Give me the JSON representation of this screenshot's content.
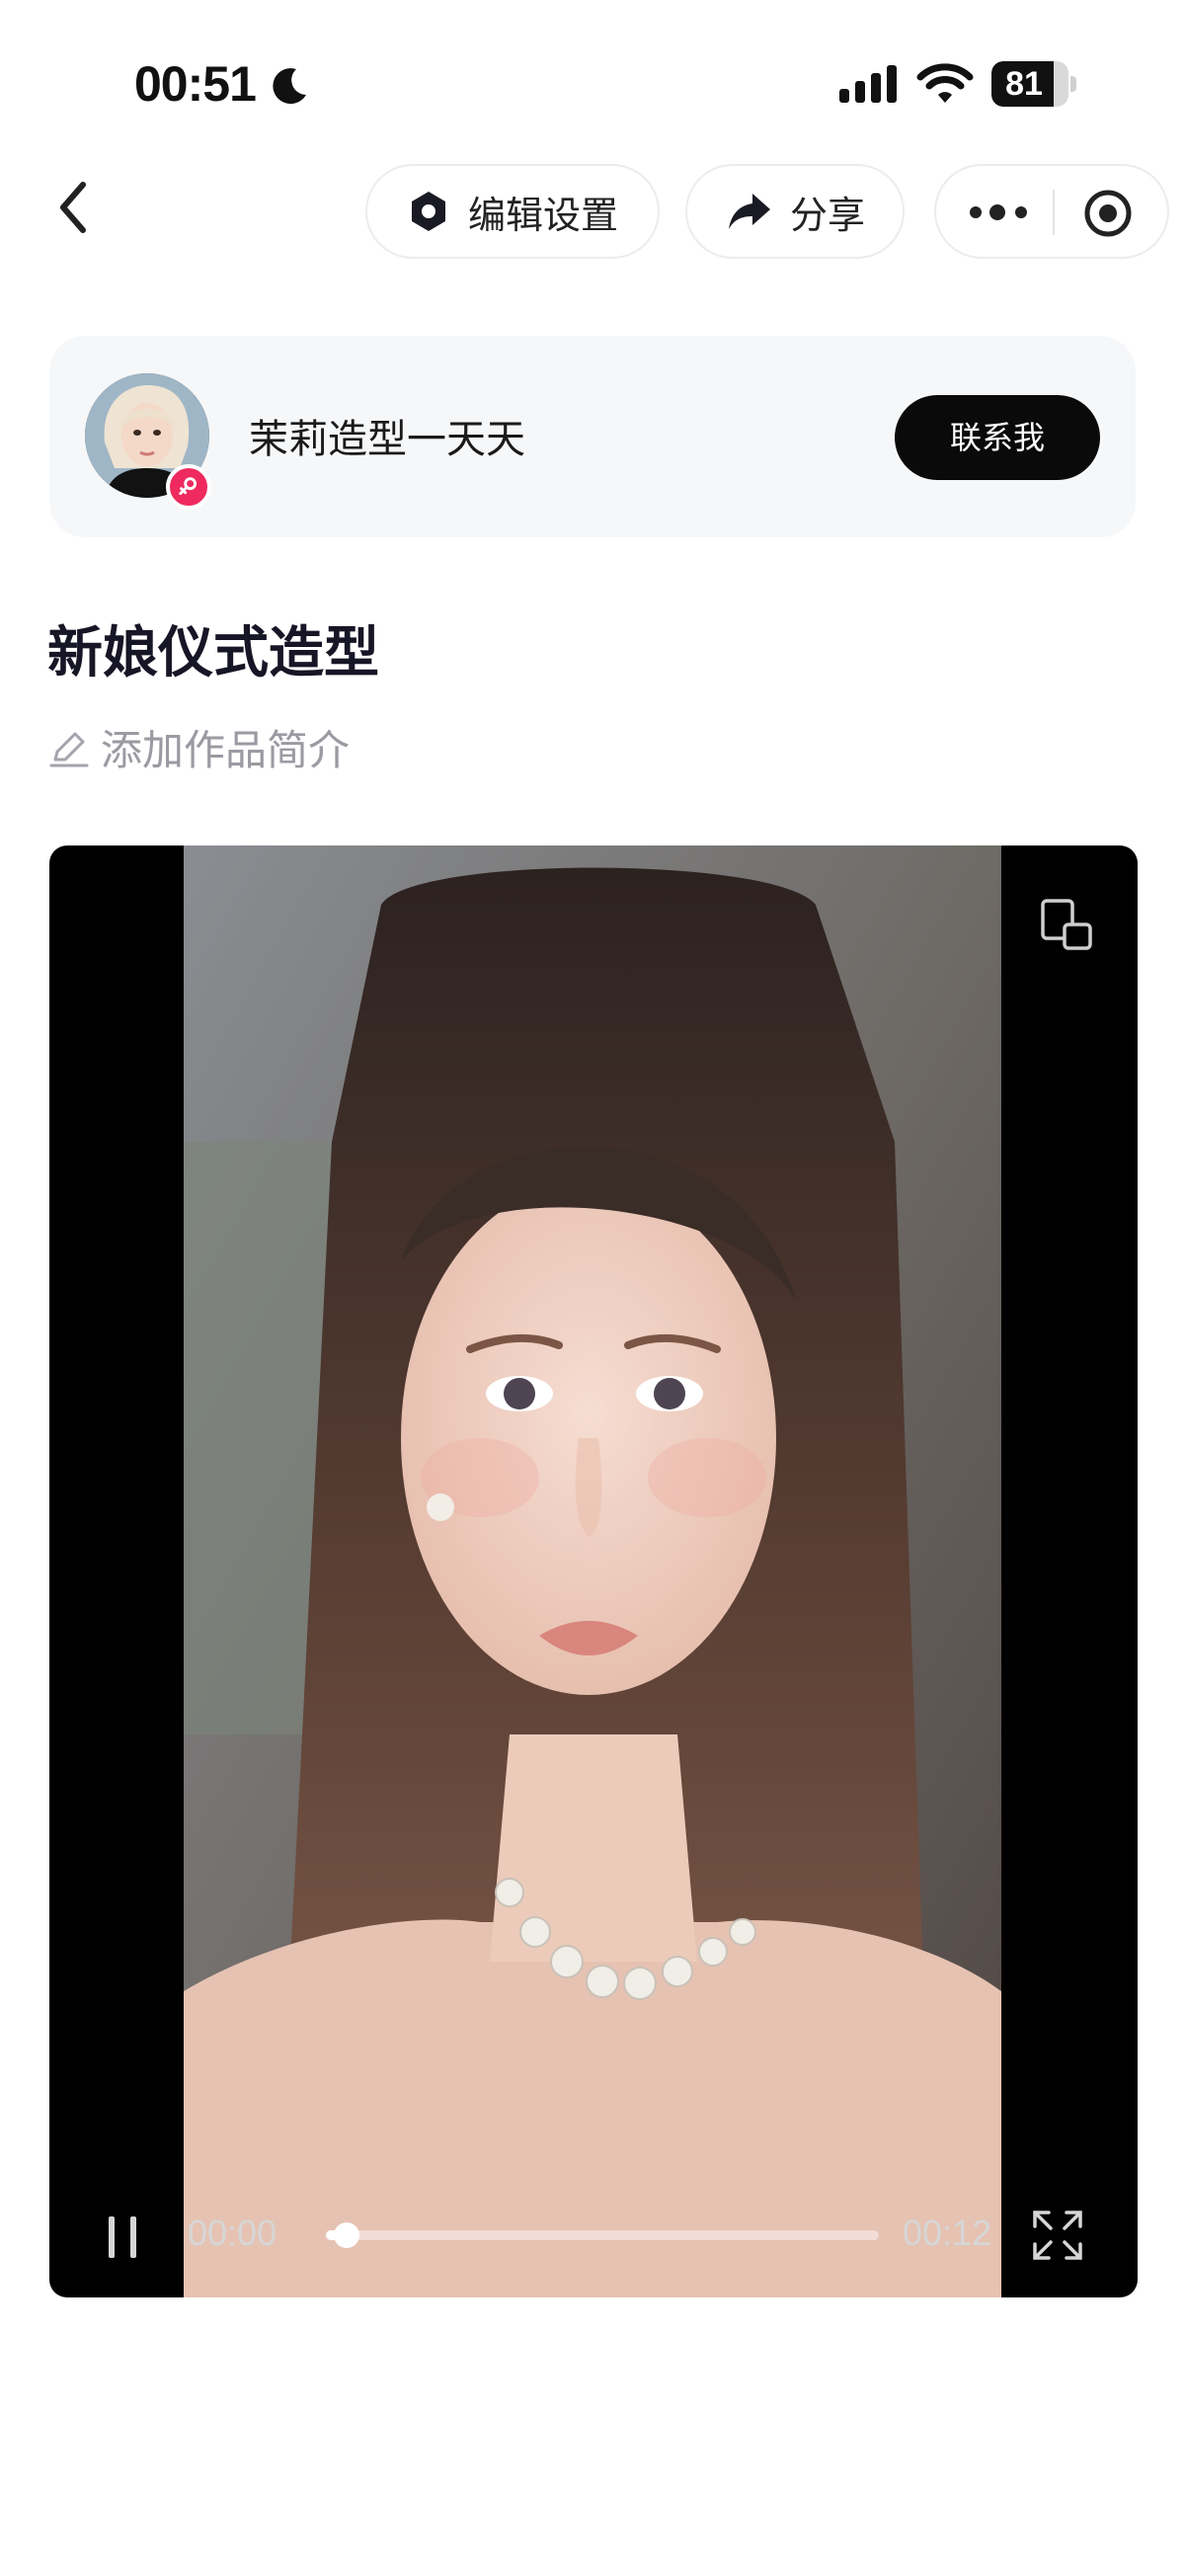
{
  "status_bar": {
    "time": "00:51",
    "battery_level": "81",
    "battery_fraction": 0.81
  },
  "nav": {
    "edit_settings_label": "编辑设置",
    "share_label": "分享"
  },
  "author": {
    "name": "茉莉造型一天天",
    "contact_label": "联系我",
    "badge_color": "#ee2a5e"
  },
  "work": {
    "title": "新娘仪式造型",
    "intro_placeholder": "添加作品简介"
  },
  "video": {
    "current_time": "00:00",
    "total_time": "00:12",
    "progress_fraction": 0.0
  },
  "icons": {
    "back": "chevron-left-icon",
    "settings": "hexagon-gear-icon",
    "share": "share-arrow-icon",
    "more": "more-dots-icon",
    "target": "record-target-icon",
    "edit": "pencil-icon",
    "pip": "picture-in-picture-icon",
    "pause": "pause-icon",
    "fullscreen": "fullscreen-icon"
  }
}
